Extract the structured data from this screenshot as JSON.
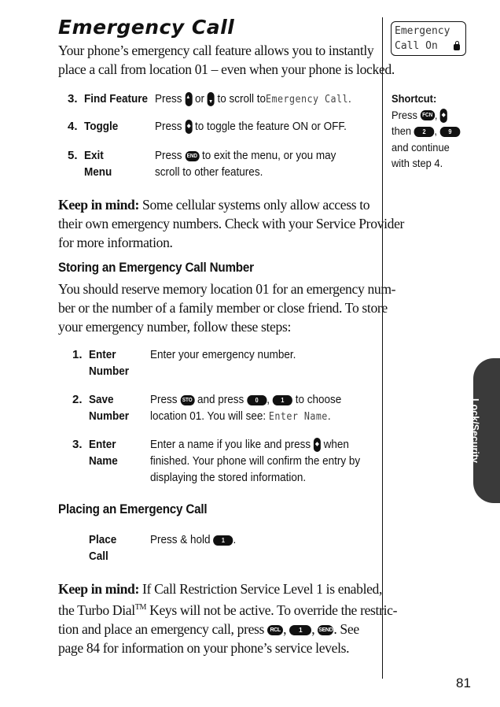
{
  "title": "Emergency Call",
  "intro": [
    "Your phone’s emergency call feature allows you to instantly",
    "place a call from location 01 – even when your phone is locked."
  ],
  "find_steps": [
    {
      "num": "3.",
      "label": [
        "Find Feature"
      ],
      "pre": "Press",
      "mid": "or",
      "post": "to scroll to",
      "lcd": "Emergency Call",
      "end": "."
    },
    {
      "num": "4.",
      "label": [
        "Toggle"
      ],
      "pre": "Press",
      "post": "to toggle the feature ON or OFF."
    },
    {
      "num": "5.",
      "label": [
        "Exit",
        "Menu"
      ],
      "pre": "Press",
      "key": "END",
      "post": "to exit the menu, or you may",
      "line2": "scroll to other features."
    }
  ],
  "keep1": {
    "bold": "Keep in mind:",
    "lines": [
      " Some cellular systems only allow access to",
      "their own emergency numbers. Check with your Service Provider",
      "for more information."
    ]
  },
  "storing": {
    "heading": "Storing an Emergency Call Number",
    "lines": [
      "You should reserve memory location 01 for an emergency num-",
      "ber or the number of a family member or close friend. To store",
      "your emergency number, follow these steps:"
    ],
    "steps": [
      {
        "num": "1.",
        "label": [
          "Enter",
          "Number"
        ],
        "text": "Enter your emergency number."
      },
      {
        "num": "2.",
        "label": [
          "Save",
          "Number"
        ],
        "pre": "Press",
        "key_sto": "STO",
        "mid": "and press",
        "key_0": "0",
        "comma": ",",
        "key_1": "1",
        "post": "to choose",
        "line2": "location 01. You will see:",
        "lcd": "Enter Name",
        "end": "."
      },
      {
        "num": "3.",
        "label": [
          "Enter",
          "Name"
        ],
        "pre": "Enter a name if you like and press",
        "post": "when",
        "line2": "finished. Your phone will confirm the entry by",
        "line3": "displaying the stored information."
      }
    ]
  },
  "placing": {
    "heading": "Placing an Emergency Call",
    "step": {
      "label": [
        "Place",
        "Call"
      ],
      "pre": "Press & hold",
      "key": "1",
      "end": "."
    }
  },
  "keep2": {
    "bold": "Keep in mind:",
    "line1": " If Call Restriction Service Level 1 is enabled,",
    "line2a": "the Turbo Dial",
    "tm": "TM",
    "line2b": " Keys will not be active. To override the restric-",
    "line3a": "tion and place an emergency call, press",
    "keys": [
      "RCL",
      "1",
      "SEND"
    ],
    "line3b": ". See",
    "line4": "page 84 for information on your phone’s service levels."
  },
  "sidebar": {
    "lcd": [
      "Emergency",
      "Call On"
    ],
    "shortcut_title": "Shortcut:",
    "press": "Press",
    "key_fcn": "FCN",
    "then": "then",
    "keys": [
      "2",
      "9"
    ],
    "line4": "and continue",
    "line5": "with step 4."
  },
  "section_tab": "Lock/Security",
  "page_number": "81"
}
